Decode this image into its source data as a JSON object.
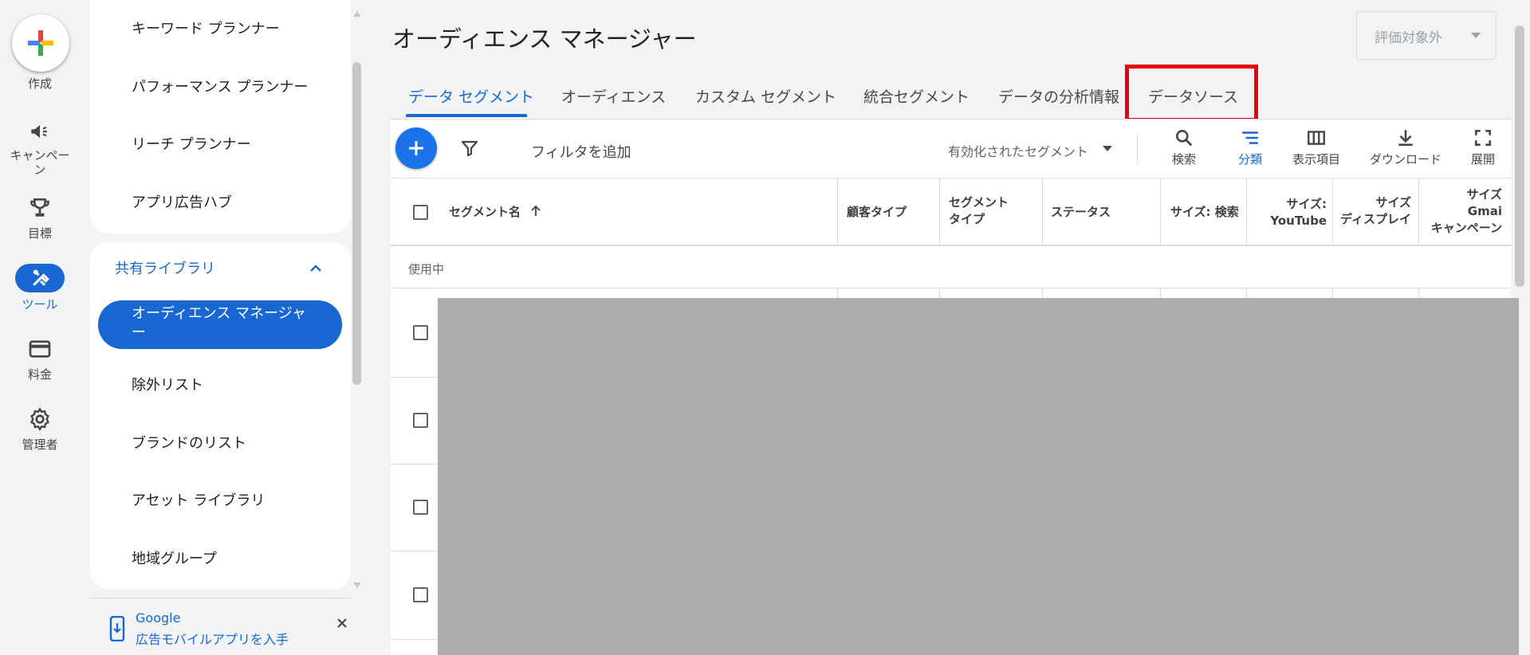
{
  "rail": {
    "create_label": "作成",
    "campaign_label": "キャンペーン",
    "goals_label": "目標",
    "tools_label": "ツール",
    "billing_label": "料金",
    "admin_label": "管理者"
  },
  "nav": {
    "top_items": [
      "キーワード プランナー",
      "パフォーマンス プランナー",
      "リーチ プランナー",
      "アプリ広告ハブ"
    ],
    "section_title": "共有ライブラリ",
    "shared_items": [
      "オーディエンス マネージャー",
      "除外リスト",
      "ブランドのリスト",
      "アセット ライブラリ",
      "地域グループ"
    ],
    "active_item_line1": "オーディエンス マネージャ",
    "active_item_line2": "ー",
    "promo_line1": "Google",
    "promo_line2": "広告モバイルアプリを入手"
  },
  "header": {
    "title": "オーディエンス マネージャー",
    "eval_dropdown": "評価対象外"
  },
  "tabs": [
    "データ セグメント",
    "オーディエンス",
    "カスタム セグメント",
    "統合セグメント",
    "データの分析情報",
    "データソース"
  ],
  "toolbar": {
    "filter_placeholder": "フィルタを追加",
    "segment_dropdown": "有効化されたセグメント",
    "search": "検索",
    "segment": "分類",
    "columns": "表示項目",
    "download": "ダウンロード",
    "expand": "展開"
  },
  "table": {
    "headers": {
      "segment_name": "セグメント名",
      "customer_type": "顧客タイプ",
      "segment_type_1": "セグメント",
      "segment_type_2": "タイプ",
      "status": "ステータス",
      "size_search": "サイズ: 検索",
      "size_youtube_1": "サイズ:",
      "size_youtube_2": "YouTube",
      "size_display_1": "サイズ",
      "size_display_2": "ディスプレイ",
      "size_gmail_1": "サイズ",
      "size_gmail_2": "Gmai",
      "size_gmail_3": "キャンペーン"
    },
    "group_label": "使用中"
  },
  "colors": {
    "primary": "#1967d2",
    "highlight": "#e8000b"
  }
}
